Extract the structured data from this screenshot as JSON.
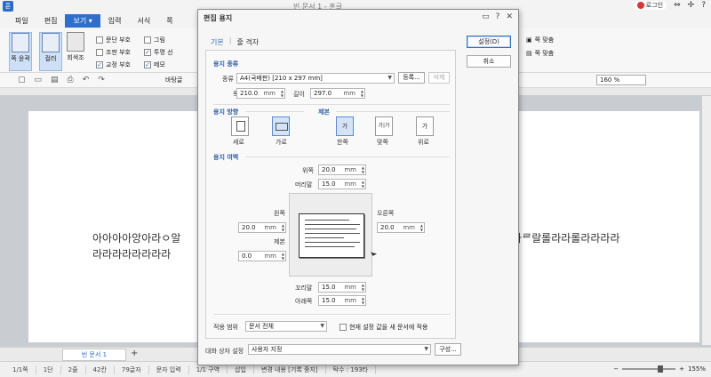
{
  "app": {
    "title": "빈 문서 1 - 훈글",
    "login_label": "로그인",
    "logo": "훈"
  },
  "menu": [
    "파일",
    "편집",
    "보기",
    "입력",
    "서식",
    "쪽"
  ],
  "ribbon": {
    "big_buttons": [
      "쪽 윤곽",
      "컬러",
      "회색조"
    ],
    "checks": [
      {
        "label": "문단 부호",
        "checked": false
      },
      {
        "label": "조판 부호",
        "checked": false
      },
      {
        "label": "교정 부호",
        "checked": true
      },
      {
        "label": "그림",
        "checked": false
      },
      {
        "label": "투명 선",
        "checked": true
      },
      {
        "label": "메모",
        "checked": true
      }
    ],
    "right": [
      "쪽 맞춤",
      "쪽 맞춤"
    ]
  },
  "toolbar": {
    "style_label": "바탕글",
    "zoom": "160 %"
  },
  "document": {
    "line1": "아아아아앙아라ㅇ알",
    "line1_right": "라라ᄅ랄롤라라롤라라라라",
    "line2": "라라라라라라라라"
  },
  "tabs": {
    "doc_tab": "빈 문서 1",
    "add": "+"
  },
  "status": [
    "1/1쪽",
    "1단",
    "2줄",
    "42칸",
    "79글자",
    "문자 입력",
    "1/1 구역",
    "삽입",
    "변경 내용 [기록 중지]",
    "탁수 : 193타"
  ],
  "zoom_level": "155%",
  "dialog": {
    "title": "편집 용지",
    "tabs": [
      "기본",
      "줄 격자"
    ],
    "buttons": {
      "ok": "설정(D)",
      "cancel": "취소",
      "register": "등록...",
      "delete": "삭제",
      "compose": "구성..."
    },
    "paper_kind": {
      "section": "용지 종류",
      "kind_label": "종류",
      "kind_value": "A4(국배판) [210 x 297 mm]",
      "width_label": "폭",
      "width_value": "210.0",
      "length_label": "길이",
      "length_value": "297.0",
      "unit": "mm"
    },
    "orientation": {
      "section": "용지 방향",
      "portrait": "세로",
      "landscape": "가로"
    },
    "binding": {
      "section": "제본",
      "one_side": "한쪽",
      "facing": "맞쪽",
      "top": "위로",
      "icon_text": [
        "가",
        "가|가",
        "가"
      ]
    },
    "margins": {
      "section": "용지 여백",
      "top_label": "위쪽",
      "top": "20.0",
      "header_label": "머리말",
      "header": "15.0",
      "left_label": "왼쪽",
      "left": "20.0",
      "binding_label": "제본",
      "binding": "0.0",
      "right_label": "오른쪽",
      "right": "20.0",
      "footer_label": "꼬리말",
      "footer": "15.0",
      "bottom_label": "아래쪽",
      "bottom": "15.0",
      "unit": "mm"
    },
    "apply": {
      "label": "적용 범위",
      "value": "문서 전체",
      "checkbox": "현재 설정 값을 새 문서에 적용"
    },
    "dialog_setting": {
      "label": "대화 상자 설정",
      "value": "사용자 지정"
    }
  }
}
